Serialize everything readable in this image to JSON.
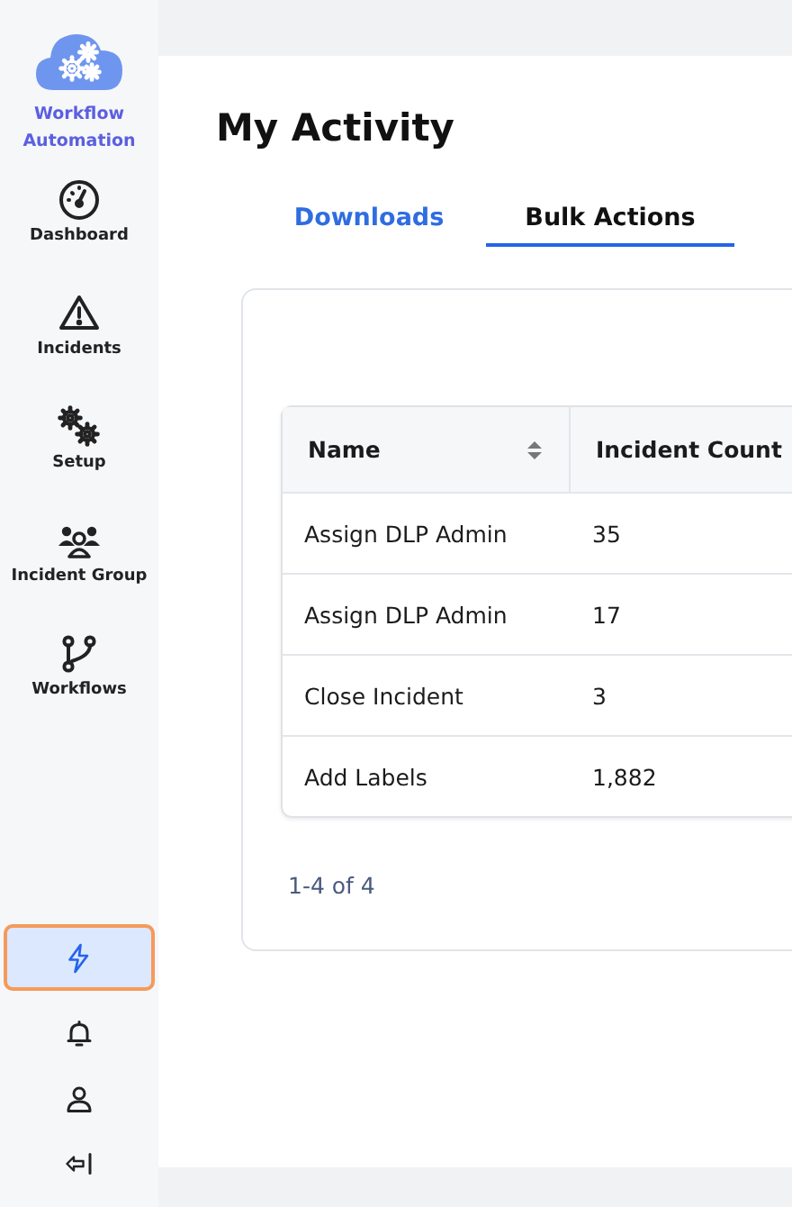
{
  "app": {
    "name": "Workflow Automation"
  },
  "sidebar": {
    "items": [
      {
        "label": "Dashboard",
        "selected": false
      },
      {
        "label": "Incidents",
        "selected": false
      },
      {
        "label": "Setup",
        "selected": false
      },
      {
        "label": "Incident Group",
        "selected": false
      },
      {
        "label": "Workflows",
        "selected": false
      }
    ],
    "bottom_items": [
      {
        "selected": true
      },
      {
        "selected": false
      },
      {
        "selected": false
      },
      {
        "selected": false
      }
    ]
  },
  "page": {
    "title": "My Activity"
  },
  "tabs": [
    {
      "label": "Downloads",
      "selected": false
    },
    {
      "label": "Bulk Actions",
      "selected": true
    }
  ],
  "table": {
    "columns": [
      {
        "label": "Name",
        "sortable": true
      },
      {
        "label": "Incident Count"
      }
    ],
    "rows": [
      [
        "Assign DLP Admin",
        "35"
      ],
      [
        "Assign DLP Admin",
        "17"
      ],
      [
        "Close Incident",
        "3"
      ],
      [
        "Add Labels",
        "1,882"
      ]
    ]
  },
  "pagination": {
    "summary": "1-4 of 4"
  }
}
